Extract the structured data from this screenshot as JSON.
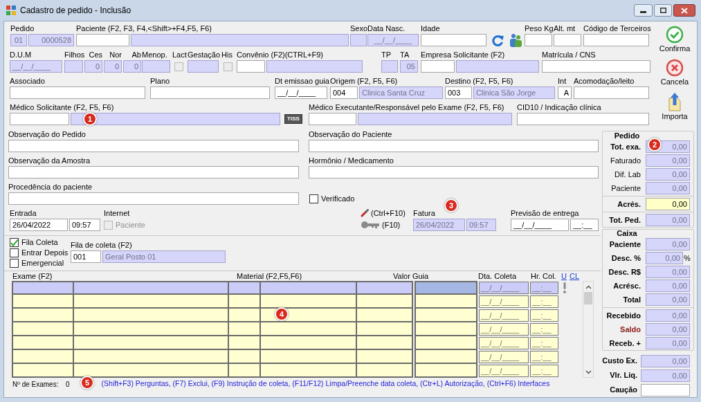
{
  "window": {
    "title": "Cadastro de pedido - Inclusão"
  },
  "top_rows": [
    [
      {
        "label": "Pedido",
        "fields": [
          {
            "kind": "lookup",
            "value": "01"
          },
          {
            "kind": "lookup",
            "value": "0000528"
          }
        ]
      },
      {
        "label": "Paciente (F2, F3, F4,<Shift>+F4,F5, F6)",
        "fields": [
          {
            "kind": "input"
          },
          {
            "kind": "lookup"
          }
        ]
      },
      {
        "label": "Sexo",
        "fields": [
          {
            "kind": "lookup"
          }
        ]
      },
      {
        "label": "Data Nasc.",
        "fields": [
          {
            "kind": "lookup",
            "value": "__/__/____"
          }
        ]
      },
      {
        "label": "Idade",
        "fields": [
          {
            "kind": "input"
          }
        ]
      },
      {
        "label": "Peso Kg",
        "fields": [
          {
            "kind": "input"
          }
        ]
      },
      {
        "label": "Alt. mt",
        "fields": [
          {
            "kind": "input"
          }
        ]
      },
      {
        "label": "Código de Terceiros",
        "fields": [
          {
            "kind": "input"
          }
        ]
      }
    ],
    [
      {
        "label": "D.U.M",
        "fields": [
          {
            "kind": "lookup",
            "value": "__/__/____"
          }
        ]
      },
      {
        "label": "Filhos",
        "fields": [
          {
            "kind": "lookup"
          }
        ]
      },
      {
        "label": "Ces",
        "fields": [
          {
            "kind": "lookup",
            "value": "0"
          }
        ]
      },
      {
        "label": "Nor",
        "fields": [
          {
            "kind": "lookup",
            "value": "0"
          }
        ]
      },
      {
        "label": "Ab",
        "fields": [
          {
            "kind": "lookup",
            "value": "0"
          }
        ]
      },
      {
        "label": "Menop.",
        "fields": [
          {
            "kind": "lookup"
          }
        ]
      },
      {
        "label": "Lact",
        "fields": [
          {
            "kind": "checkbox",
            "checked": false,
            "disabled": true
          }
        ]
      },
      {
        "label": "Gestação",
        "fields": [
          {
            "kind": "lookup"
          }
        ]
      },
      {
        "label": "His",
        "fields": [
          {
            "kind": "checkbox",
            "checked": false,
            "disabled": true
          }
        ]
      },
      {
        "label": "Convênio (F2)(CTRL+F9)",
        "fields": [
          {
            "kind": "input"
          },
          {
            "kind": "lookup"
          }
        ]
      },
      {
        "label": "TP",
        "fields": [
          {
            "kind": "lookup"
          }
        ]
      },
      {
        "label": "TA",
        "fields": [
          {
            "kind": "lookup",
            "value": "05"
          }
        ]
      },
      {
        "label": "Empresa Solicitante (F2)",
        "fields": [
          {
            "kind": "input"
          },
          {
            "kind": "lookup"
          }
        ]
      },
      {
        "label": "Matrícula / CNS",
        "fields": [
          {
            "kind": "input"
          }
        ]
      }
    ],
    [
      {
        "label": "Associado",
        "fields": [
          {
            "kind": "input"
          }
        ]
      },
      {
        "label": "Plano",
        "fields": [
          {
            "kind": "input"
          }
        ]
      },
      {
        "label": "Dt emissao guia",
        "fields": [
          {
            "kind": "input",
            "value": "__/__/____"
          }
        ]
      },
      {
        "label": "Origem  (F2, F5, F6)",
        "fields": [
          {
            "kind": "input",
            "value": "004"
          },
          {
            "kind": "lookup",
            "value": "Clinica Santa Cruz"
          }
        ]
      },
      {
        "label": "Destino (F2, F5, F6)",
        "fields": [
          {
            "kind": "input",
            "value": "003"
          },
          {
            "kind": "lookup",
            "value": "Clinica São Jorge"
          }
        ]
      },
      {
        "label": "Int",
        "fields": [
          {
            "kind": "input",
            "value": "A"
          }
        ]
      },
      {
        "label": "Acomodação/leito",
        "fields": [
          {
            "kind": "input"
          }
        ]
      }
    ],
    [
      {
        "label": "Médico Solicitante  (F2, F5, F6)",
        "fields": [
          {
            "kind": "input"
          },
          {
            "kind": "lookup"
          }
        ]
      },
      {
        "label": "Médico Executante/Responsável pelo Exame (F2, F5, F6)",
        "fields": [
          {
            "kind": "input"
          },
          {
            "kind": "lookup"
          }
        ]
      },
      {
        "label": "CID10 / Indicação clínica",
        "fields": [
          {
            "kind": "input"
          }
        ]
      }
    ]
  ],
  "tiss_badge": "TISS",
  "actions": [
    "Confirma",
    "Cancela",
    "Importa"
  ],
  "bottom_rows": [
    [
      {
        "label": "Observação do Pedido",
        "fields": [
          {
            "kind": "input"
          }
        ]
      },
      {
        "label": "Observação do Paciente",
        "fields": [
          {
            "kind": "input"
          }
        ]
      }
    ],
    [
      {
        "label": "Observação da Amostra",
        "fields": [
          {
            "kind": "input"
          }
        ]
      },
      {
        "label": "Hormônio / Medicamento",
        "fields": [
          {
            "kind": "input"
          }
        ]
      }
    ],
    [
      {
        "label": "Procedência do paciente",
        "fields": [
          {
            "kind": "input"
          }
        ]
      },
      {
        "fields": [
          {
            "kind": "checkbox",
            "text": "Verificado",
            "checked": false,
            "disabled": false
          }
        ]
      }
    ],
    [
      {
        "label": "Entrada",
        "fields": [
          {
            "kind": "input",
            "value": "26/04/2022"
          },
          {
            "kind": "input",
            "value": "09:57"
          }
        ]
      },
      {
        "label": "Internet",
        "fields": [
          {
            "kind": "checkbox",
            "text": "Paciente",
            "checked": false,
            "disabled": true
          }
        ]
      },
      {
        "shortcuts": [
          "(Ctrl+F10)",
          "(F10)"
        ]
      },
      {
        "label": "Fatura",
        "fields": [
          {
            "kind": "lookup",
            "value": "26/04/2022"
          },
          {
            "kind": "lookup",
            "value": "09:57"
          }
        ]
      },
      {
        "label": "Previsão de entrega",
        "fields": [
          {
            "kind": "input",
            "value": "__/__/____"
          },
          {
            "kind": "input",
            "value": "__:__"
          }
        ]
      }
    ]
  ],
  "queue": {
    "options": [
      {
        "text": "Fila Coleta",
        "checked": true
      },
      {
        "text": "Entrar Depois",
        "checked": false
      },
      {
        "text": "Emergencial",
        "checked": false
      }
    ],
    "group": {
      "label": "Fila de coleta (F2)",
      "fields": [
        {
          "kind": "input",
          "value": "001"
        },
        {
          "kind": "lookup",
          "value": "Geral Posto 01"
        }
      ]
    }
  },
  "exams": {
    "columns": [
      "Exame (F2)",
      "Material (F2,F5,F6)",
      "Valor Guia",
      "Dta. Coleta",
      "Hr. Col."
    ],
    "links": [
      "U",
      "CL"
    ],
    "rows": [
      {
        "selected": true,
        "date": "__/__/____",
        "time": "__:__"
      },
      {
        "selected": false,
        "date": "__/__/____",
        "time": "__:__"
      },
      {
        "selected": false,
        "date": "__/__/____",
        "time": "__:__"
      },
      {
        "selected": false,
        "date": "__/__/____",
        "time": "__:__"
      },
      {
        "selected": false,
        "date": "__/__/____",
        "time": "__:__"
      },
      {
        "selected": false,
        "date": "__/__/____",
        "time": "__:__"
      },
      {
        "selected": false,
        "date": "__/__/____",
        "time": "__:__"
      }
    ],
    "count_label": "Nº de Exames:",
    "count": "0",
    "hint": "(Shift+F3) Perguntas, (F7) Exclui, (F9) Instrução de coleta, (F11/F12) Limpa/Preenche data coleta, (Ctr+L) Autorização, (Ctrl+F6) Interfaces"
  },
  "totals": {
    "pedido": {
      "title": "Pedido",
      "sections": [
        [
          {
            "label": "Tot. exa.",
            "value": "0,00",
            "bold": true,
            "alert": false,
            "kind": "lookup"
          },
          {
            "label": "Faturado",
            "value": "0,00",
            "bold": false,
            "alert": false,
            "kind": "lookup"
          },
          {
            "label": "Dif. Lab",
            "value": "0,00",
            "bold": false,
            "alert": false,
            "kind": "lookup"
          },
          {
            "label": "Paciente",
            "value": "0,00",
            "bold": false,
            "alert": false,
            "kind": "lookup"
          }
        ],
        [
          {
            "label": "Acrés.",
            "value": "0,00",
            "bold": true,
            "alert": false,
            "kind": "highlight"
          }
        ],
        [
          {
            "label": "Tot. Ped.",
            "value": "0,00",
            "bold": true,
            "alert": false,
            "kind": "lookup"
          }
        ]
      ]
    },
    "caixa": {
      "title": "Caixa",
      "sections": [
        [
          {
            "label": "Paciente",
            "value": "0,00",
            "bold": true,
            "alert": false,
            "kind": "lookup"
          },
          {
            "label": "Desc. %",
            "value": "0,00",
            "suffix": "%",
            "bold": true,
            "alert": false,
            "kind": "lookup"
          },
          {
            "label": "Desc. R$",
            "value": "0,00",
            "bold": true,
            "alert": false,
            "kind": "lookup"
          },
          {
            "label": "Acrésc.",
            "value": "0,00",
            "bold": true,
            "alert": false,
            "kind": "lookup"
          },
          {
            "label": "Total",
            "value": "0,00",
            "bold": true,
            "alert": false,
            "kind": "lookup"
          }
        ],
        [
          {
            "label": "Recebido",
            "value": "0,00",
            "bold": true,
            "alert": false,
            "kind": "lookup"
          },
          {
            "label": "Saldo",
            "value": "0,00",
            "bold": true,
            "alert": true,
            "kind": "lookup"
          },
          {
            "label": "Receb. +",
            "value": "0,00",
            "bold": true,
            "alert": false,
            "kind": "lookup"
          }
        ]
      ]
    },
    "summary": [
      {
        "label": "Custo Ex.",
        "value": "0,00",
        "bold": true,
        "alert": false,
        "kind": "lookup"
      },
      {
        "label": "Vlr. Liq.",
        "value": "0,00",
        "bold": true,
        "alert": false,
        "kind": "lookup"
      },
      {
        "label": "Caução",
        "bold": true,
        "alert": false,
        "kind": "input"
      }
    ]
  },
  "callouts": [
    "1",
    "2",
    "3",
    "4",
    "5"
  ]
}
